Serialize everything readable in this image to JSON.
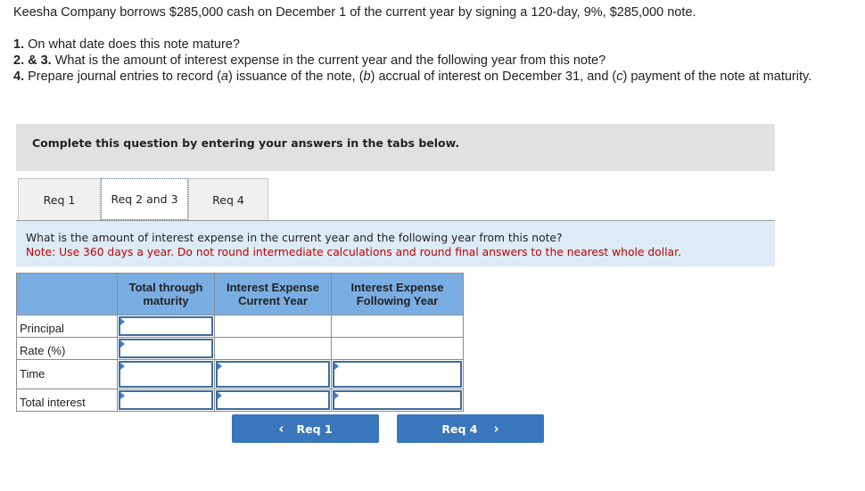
{
  "problem": {
    "intro": "Keesha Company borrows $285,000 cash on December 1 of the current year by signing a 120-day, 9%, $285,000 note.",
    "questions": [
      {
        "num": "1.",
        "text": " On what date does this note mature?"
      },
      {
        "num": "2. & 3.",
        "text": " What is the amount of interest expense in the current year and the following year from this note?"
      },
      {
        "num": "4.",
        "text_parts": [
          " Prepare journal entries to record (",
          "a",
          ") issuance of the note, (",
          "b",
          ") accrual of interest on December 31, and (",
          "c",
          ") payment of the note at maturity."
        ]
      }
    ]
  },
  "instruction": "Complete this question by entering your answers in the tabs below.",
  "tabs": [
    {
      "label": "Req 1",
      "active": false
    },
    {
      "label": "Req 2 and 3",
      "active": true
    },
    {
      "label": "Req 4",
      "active": false
    }
  ],
  "question_box": {
    "question": "What is the amount of interest expense in the current year and the following year from this note?",
    "note": "Note: Use 360 days a year. Do not round intermediate calculations and round final answers to the nearest whole dollar."
  },
  "table": {
    "headers": [
      "",
      "Total through maturity",
      "Interest Expense Current Year",
      "Interest Expense Following Year"
    ],
    "header_lines": [
      [
        ""
      ],
      [
        "Total through",
        "maturity"
      ],
      [
        "Interest Expense",
        "Current Year"
      ],
      [
        "Interest Expense",
        "Following Year"
      ]
    ],
    "rows": [
      {
        "label": "Principal",
        "values": [
          "",
          "",
          ""
        ]
      },
      {
        "label": "Rate (%)",
        "values": [
          "",
          "",
          ""
        ]
      },
      {
        "label": "Time",
        "values": [
          "",
          "",
          ""
        ]
      },
      {
        "label": "Total interest",
        "values": [
          "",
          "",
          ""
        ]
      }
    ]
  },
  "nav": {
    "prev_label": "Req 1",
    "next_label": "Req 4",
    "prev_icon": "chevron-left-icon",
    "next_icon": "chevron-right-icon"
  },
  "colors": {
    "header_bg": "#7aaee3",
    "question_bg": "#ddebf7",
    "note_color": "#c00000",
    "button_bg": "#3a76bb",
    "input_border": "#3f6d9e"
  }
}
